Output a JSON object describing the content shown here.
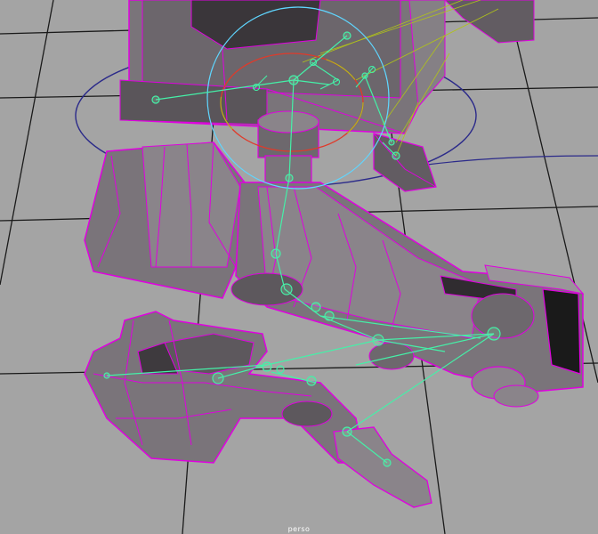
{
  "viewport": {
    "camera_label": "perso",
    "background_color": "#a4a4a4",
    "grid_color": "#1a1a1a"
  },
  "scene": {
    "mesh_wire_color": "#e000e0",
    "mesh_fill_color": "#767076",
    "mesh_shadow_color": "#454045",
    "joint_color": "#45f0a8",
    "control_ring_color": "#2b2a8a",
    "control_circle_cyan": "#5fd6ff",
    "control_circle_red": "#e03a2a",
    "ik_handle_color": "#b0c21a"
  }
}
